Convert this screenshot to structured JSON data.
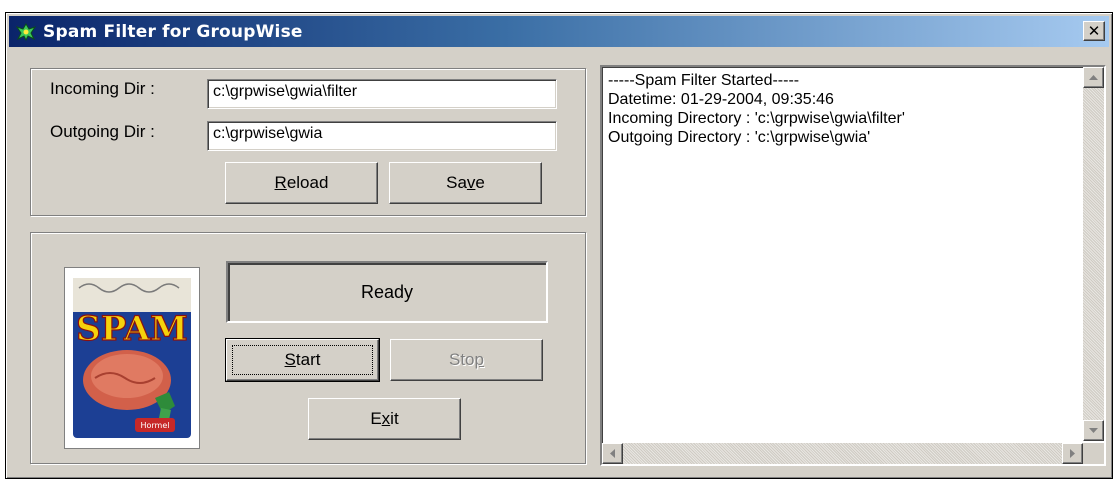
{
  "window": {
    "title": "Spam Filter for GroupWise",
    "close_label": "✕"
  },
  "config": {
    "incoming_label": "Incoming Dir :",
    "incoming_value": "c:\\grpwise\\gwia\\filter",
    "outgoing_label": "Outgoing Dir :",
    "outgoing_value": "c:\\grpwise\\gwia"
  },
  "buttons": {
    "reload": {
      "before": "",
      "accel": "R",
      "after": "eload"
    },
    "save": {
      "before": "Sa",
      "accel": "v",
      "after": "e"
    },
    "start": {
      "before": "",
      "accel": "S",
      "after": "tart"
    },
    "stop": {
      "before": "Sto",
      "accel": "p",
      "after": ""
    },
    "exit": {
      "before": "E",
      "accel": "x",
      "after": "it"
    }
  },
  "status": {
    "text": "Ready"
  },
  "image": {
    "brand_text": "SPAM",
    "label_text": "Hormel"
  },
  "log": {
    "lines": [
      "-----Spam Filter Started-----",
      "Datetime: 01-29-2004, 09:35:46",
      "Incoming Directory : 'c:\\grpwise\\gwia\\filter'",
      "Outgoing Directory : 'c:\\grpwise\\gwia'"
    ]
  },
  "icons": {
    "app": "spam-filter-app-icon",
    "close": "close-icon",
    "scroll_up": "scroll-up-arrow-icon",
    "scroll_down": "scroll-down-arrow-icon",
    "scroll_left": "scroll-left-arrow-icon",
    "scroll_right": "scroll-right-arrow-icon"
  },
  "colors": {
    "titlebar_start": "#0a246a",
    "titlebar_end": "#a6caf0",
    "face": "#d4d0c8",
    "spam_can_blue": "#1c3f94",
    "spam_logo_yellow": "#f5d20c",
    "spam_meat": "#d2604a"
  }
}
